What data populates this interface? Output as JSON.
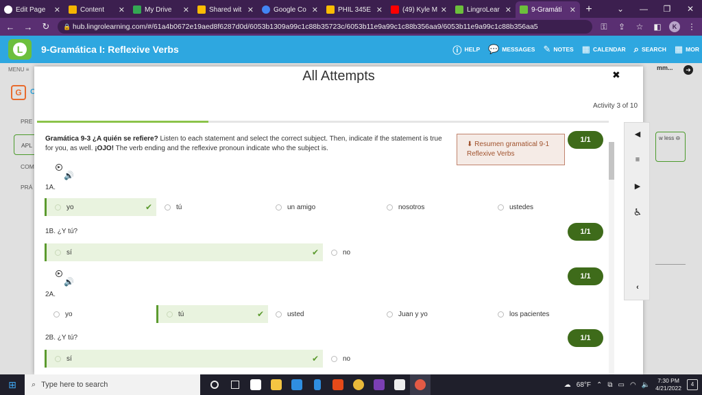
{
  "browser": {
    "tabs": [
      {
        "label": "Edit Page",
        "color": "#ffffff",
        "icon": "github-icon"
      },
      {
        "label": "Content",
        "color": "#f4b400",
        "icon": "content-icon"
      },
      {
        "label": "My Drive",
        "color": "#34a853",
        "icon": "drive-icon"
      },
      {
        "label": "Shared wit",
        "color": "#fbbc04",
        "icon": "drive-icon"
      },
      {
        "label": "Google Co",
        "color": "#4285f4",
        "icon": "classroom-icon"
      },
      {
        "label": "PHIL 345E",
        "color": "#fbbc04",
        "icon": "drive-icon"
      },
      {
        "label": "(49) Kyle M",
        "color": "#ff0000",
        "icon": "youtube-icon"
      },
      {
        "label": "LingroLear",
        "color": "#6cbf3c",
        "icon": "lingro-icon"
      },
      {
        "label": "9-Gramáti",
        "color": "#6cbf3c",
        "icon": "lingro-icon"
      }
    ],
    "url": "hub.lingrolearning.com/#/61a4b0672e19aed8f6287d0d/6053b1309a99c1c88b35723c/6053b11e9a99c1c88b356aa9/6053b11e9a99c1c88b356aa5",
    "profile_initial": "K"
  },
  "app": {
    "title": "9-Gramática I: Reflexive Verbs",
    "nav": {
      "help": "HELP",
      "messages": "MESSAGES",
      "notes": "NOTES",
      "calendar": "CALENDAR",
      "search": "SEARCH",
      "more": "MOR"
    }
  },
  "background": {
    "menu": "MENU",
    "logo_letter": "G",
    "logo_suffix": "C",
    "items": [
      "PRE",
      "APL",
      "COM",
      "PRÁ"
    ],
    "top_right": "mm...",
    "show_less": "w less"
  },
  "modal": {
    "title": "All Attempts",
    "activity": "Activity 3 of 10",
    "progress": 0.3,
    "instructions_title": "Gramática 9-3 ¿A quién se refiere?",
    "instructions_body": " Listen to each statement and select the correct subject. Then, indicate if the statement is true for you, as well. ",
    "instructions_bold": "¡OJO!",
    "instructions_tail": " The verb ending and the reflexive pronoun indicate who the subject is.",
    "resumen_line1": "Resumen gramatical 9-1",
    "resumen_line2": "Reflexive Verbs",
    "questions": [
      {
        "label": "1A.",
        "score": "1/1",
        "options": [
          "yo",
          "tú",
          "un amigo",
          "nosotros",
          "ustedes"
        ],
        "selected": 0
      },
      {
        "label": "1B. ¿Y tú?",
        "score": "1/1",
        "options": [
          "sí",
          "no"
        ],
        "selected": 0
      },
      {
        "label": "2A.",
        "score": "1/1",
        "options": [
          "yo",
          "tú",
          "usted",
          "Juan y yo",
          "los pacientes"
        ],
        "selected": 1
      },
      {
        "label": "2B. ¿Y tú?",
        "score": "1/1",
        "options": [
          "sí",
          "no"
        ],
        "selected": 0
      }
    ]
  },
  "taskbar": {
    "search_placeholder": "Type here to search",
    "weather": "68°F",
    "time": "7:30 PM",
    "date": "4/21/2022",
    "notifications": "4"
  }
}
